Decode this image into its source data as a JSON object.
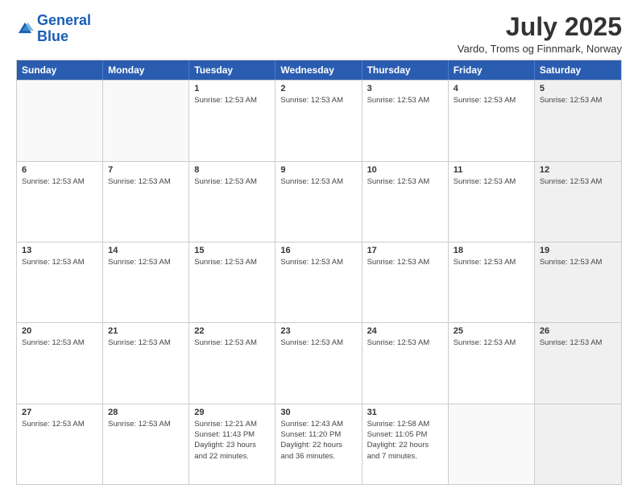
{
  "logo": {
    "line1": "General",
    "line2": "Blue"
  },
  "title": "July 2025",
  "location": "Vardo, Troms og Finnmark, Norway",
  "days_of_week": [
    "Sunday",
    "Monday",
    "Tuesday",
    "Wednesday",
    "Thursday",
    "Friday",
    "Saturday"
  ],
  "weeks": [
    [
      {
        "day": "",
        "info": [],
        "empty": true
      },
      {
        "day": "",
        "info": [],
        "empty": true
      },
      {
        "day": "1",
        "info": [
          "Sunrise: 12:53 AM"
        ],
        "empty": false
      },
      {
        "day": "2",
        "info": [
          "Sunrise: 12:53 AM"
        ],
        "empty": false
      },
      {
        "day": "3",
        "info": [
          "Sunrise: 12:53 AM"
        ],
        "empty": false
      },
      {
        "day": "4",
        "info": [
          "Sunrise: 12:53 AM"
        ],
        "empty": false
      },
      {
        "day": "5",
        "info": [
          "Sunrise: 12:53 AM"
        ],
        "empty": false,
        "shaded": true
      }
    ],
    [
      {
        "day": "6",
        "info": [
          "Sunrise: 12:53 AM"
        ],
        "empty": false
      },
      {
        "day": "7",
        "info": [
          "Sunrise: 12:53 AM"
        ],
        "empty": false
      },
      {
        "day": "8",
        "info": [
          "Sunrise: 12:53 AM"
        ],
        "empty": false
      },
      {
        "day": "9",
        "info": [
          "Sunrise: 12:53 AM"
        ],
        "empty": false
      },
      {
        "day": "10",
        "info": [
          "Sunrise: 12:53 AM"
        ],
        "empty": false
      },
      {
        "day": "11",
        "info": [
          "Sunrise: 12:53 AM"
        ],
        "empty": false
      },
      {
        "day": "12",
        "info": [
          "Sunrise: 12:53 AM"
        ],
        "empty": false,
        "shaded": true
      }
    ],
    [
      {
        "day": "13",
        "info": [
          "Sunrise: 12:53 AM"
        ],
        "empty": false
      },
      {
        "day": "14",
        "info": [
          "Sunrise: 12:53 AM"
        ],
        "empty": false
      },
      {
        "day": "15",
        "info": [
          "Sunrise: 12:53 AM"
        ],
        "empty": false
      },
      {
        "day": "16",
        "info": [
          "Sunrise: 12:53 AM"
        ],
        "empty": false
      },
      {
        "day": "17",
        "info": [
          "Sunrise: 12:53 AM"
        ],
        "empty": false
      },
      {
        "day": "18",
        "info": [
          "Sunrise: 12:53 AM"
        ],
        "empty": false
      },
      {
        "day": "19",
        "info": [
          "Sunrise: 12:53 AM"
        ],
        "empty": false,
        "shaded": true
      }
    ],
    [
      {
        "day": "20",
        "info": [
          "Sunrise: 12:53 AM"
        ],
        "empty": false
      },
      {
        "day": "21",
        "info": [
          "Sunrise: 12:53 AM"
        ],
        "empty": false
      },
      {
        "day": "22",
        "info": [
          "Sunrise: 12:53 AM"
        ],
        "empty": false
      },
      {
        "day": "23",
        "info": [
          "Sunrise: 12:53 AM"
        ],
        "empty": false
      },
      {
        "day": "24",
        "info": [
          "Sunrise: 12:53 AM"
        ],
        "empty": false
      },
      {
        "day": "25",
        "info": [
          "Sunrise: 12:53 AM"
        ],
        "empty": false
      },
      {
        "day": "26",
        "info": [
          "Sunrise: 12:53 AM"
        ],
        "empty": false,
        "shaded": true
      }
    ],
    [
      {
        "day": "27",
        "info": [
          "Sunrise: 12:53 AM"
        ],
        "empty": false
      },
      {
        "day": "28",
        "info": [
          "Sunrise: 12:53 AM"
        ],
        "empty": false
      },
      {
        "day": "29",
        "info": [
          "Sunrise: 12:21 AM",
          "Sunset: 11:43 PM",
          "Daylight: 23 hours and 22 minutes."
        ],
        "empty": false
      },
      {
        "day": "30",
        "info": [
          "Sunrise: 12:43 AM",
          "Sunset: 11:20 PM",
          "Daylight: 22 hours and 36 minutes."
        ],
        "empty": false
      },
      {
        "day": "31",
        "info": [
          "Sunrise: 12:58 AM",
          "Sunset: 11:05 PM",
          "Daylight: 22 hours and 7 minutes."
        ],
        "empty": false
      },
      {
        "day": "",
        "info": [],
        "empty": true
      },
      {
        "day": "",
        "info": [],
        "empty": true,
        "shaded": true
      }
    ]
  ]
}
